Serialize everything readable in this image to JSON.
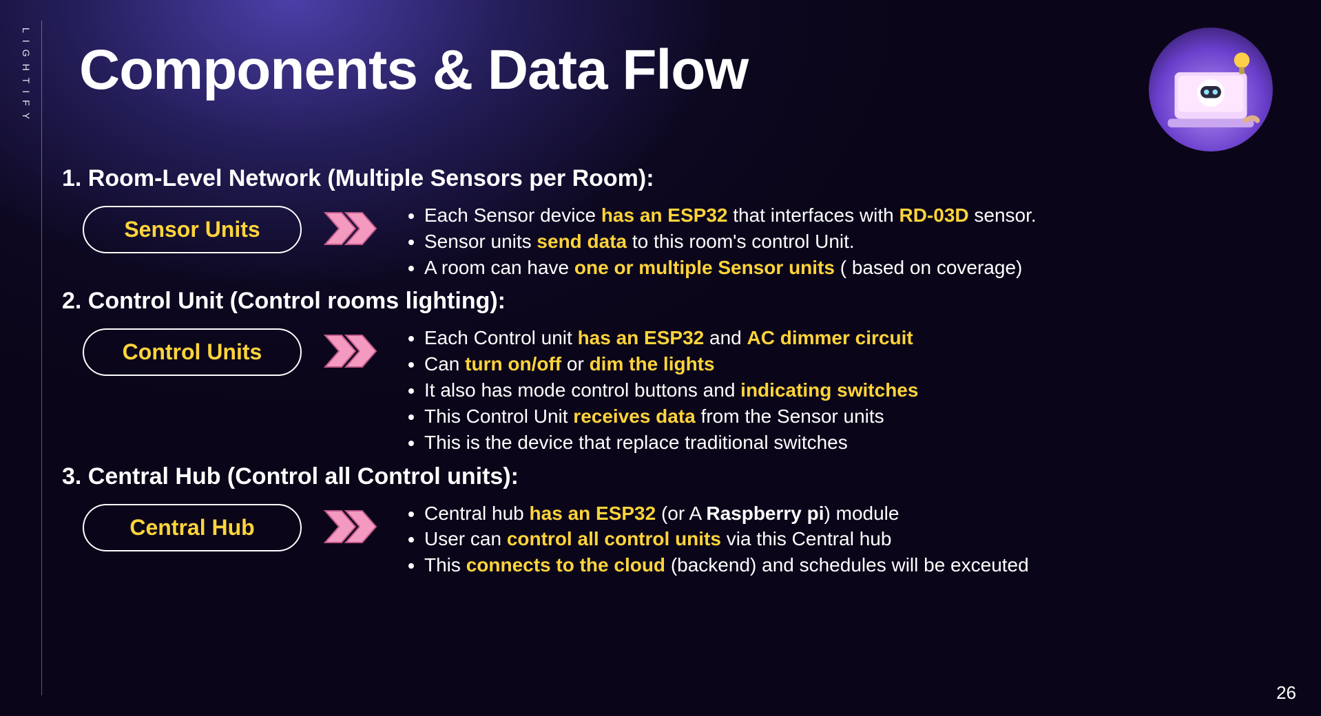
{
  "brand": "LIGHTIFY",
  "title": "Components & Data Flow",
  "page_number": "26",
  "sections": [
    {
      "heading": "1. Room-Level Network (Multiple Sensors per Room):",
      "pill": "Sensor Units",
      "bullets": [
        [
          {
            "t": "Each Sensor device "
          },
          {
            "t": "has an ESP32",
            "c": "hl"
          },
          {
            "t": " that interfaces with "
          },
          {
            "t": "RD-03D",
            "c": "hl"
          },
          {
            "t": " sensor."
          }
        ],
        [
          {
            "t": "Sensor units "
          },
          {
            "t": "send data",
            "c": "hl"
          },
          {
            "t": " to this room's control Unit."
          }
        ],
        [
          {
            "t": "A room can have "
          },
          {
            "t": "one or multiple Sensor units",
            "c": "hl"
          },
          {
            "t": " ( based on coverage)"
          }
        ]
      ]
    },
    {
      "heading": "2. Control Unit (Control rooms lighting):",
      "pill": "Control Units",
      "bullets": [
        [
          {
            "t": "Each Control unit "
          },
          {
            "t": "has an ESP32",
            "c": "hl"
          },
          {
            "t": "  and "
          },
          {
            "t": "AC dimmer circuit",
            "c": "hl"
          }
        ],
        [
          {
            "t": "Can "
          },
          {
            "t": "turn on/off",
            "c": "hl"
          },
          {
            "t": " or "
          },
          {
            "t": "dim the lights",
            "c": "hl"
          }
        ],
        [
          {
            "t": "It also has mode control buttons and "
          },
          {
            "t": "indicating switches",
            "c": "hl"
          }
        ],
        [
          {
            "t": "This Control Unit "
          },
          {
            "t": "receives data",
            "c": "hl"
          },
          {
            "t": " from the Sensor units"
          }
        ],
        [
          {
            "t": "This is the device that replace traditional switches"
          }
        ]
      ]
    },
    {
      "heading": "3. Central Hub (Control all Control units):",
      "pill": "Central Hub",
      "bullets": [
        [
          {
            "t": "Central hub "
          },
          {
            "t": "has an ESP32",
            "c": "hl"
          },
          {
            "t": " (or A "
          },
          {
            "t": "Raspberry pi",
            "c": "bw"
          },
          {
            "t": ") module"
          }
        ],
        [
          {
            "t": "User can "
          },
          {
            "t": "control all control units",
            "c": "hl"
          },
          {
            "t": " via this Central hub"
          }
        ],
        [
          {
            "t": "This "
          },
          {
            "t": "connects to the cloud",
            "c": "hl"
          },
          {
            "t": " (backend) and  schedules will be exceuted"
          }
        ]
      ]
    }
  ]
}
